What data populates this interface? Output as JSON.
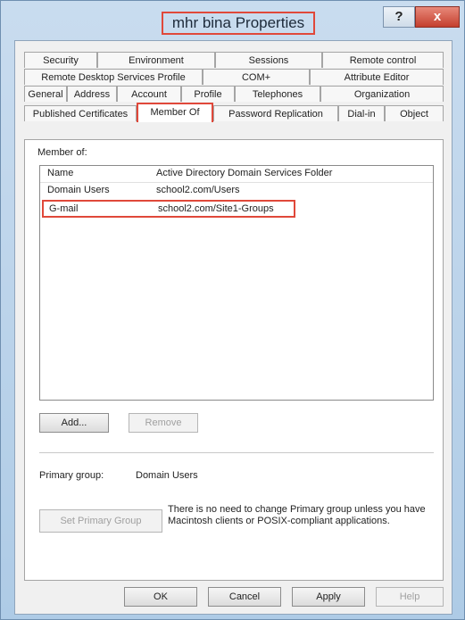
{
  "window": {
    "title": "mhr bina Properties",
    "help_label": "?",
    "close_label": "x"
  },
  "tabs": {
    "row1": [
      "Security",
      "Environment",
      "Sessions",
      "Remote control"
    ],
    "row2": [
      "Remote Desktop Services Profile",
      "COM+",
      "Attribute Editor"
    ],
    "row3": [
      "General",
      "Address",
      "Account",
      "Profile",
      "Telephones",
      "Organization"
    ],
    "row4": [
      "Published Certificates",
      "Member Of",
      "Password Replication",
      "Dial-in",
      "Object"
    ]
  },
  "member_of": {
    "label": "Member of:",
    "columns": [
      "Name",
      "Active Directory Domain Services Folder"
    ],
    "rows": [
      {
        "name": "Domain Users",
        "folder": "school2.com/Users"
      },
      {
        "name": "G-mail",
        "folder": "school2.com/Site1-Groups"
      }
    ]
  },
  "buttons": {
    "add": "Add...",
    "remove": "Remove",
    "set_primary": "Set Primary Group",
    "ok": "OK",
    "cancel": "Cancel",
    "apply": "Apply",
    "help": "Help"
  },
  "primary": {
    "label": "Primary group:",
    "value": "Domain Users"
  },
  "note": "There is no need to change Primary group unless you have Macintosh clients or POSIX-compliant applications."
}
